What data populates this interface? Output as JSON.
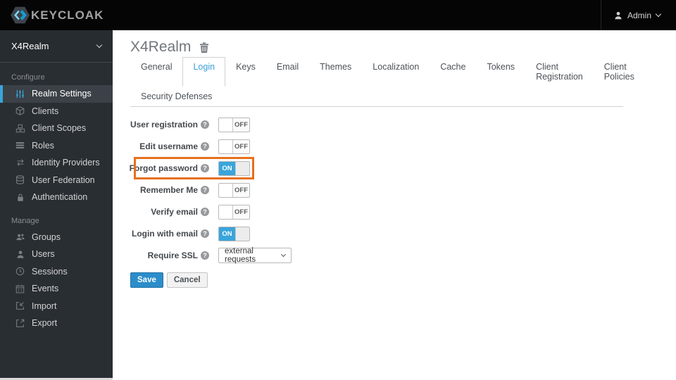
{
  "topnav": {
    "brand": "KEYCLOAK",
    "user": {
      "label": "Admin",
      "icon": "person-icon"
    }
  },
  "sidebar": {
    "realm_selector": {
      "label": "X4Realm",
      "icon": "chevron-down-icon"
    },
    "sections": [
      {
        "label": "Configure",
        "items": [
          {
            "label": "Realm Settings",
            "icon": "sliders-icon",
            "active": true
          },
          {
            "label": "Clients",
            "icon": "cube-icon",
            "active": false
          },
          {
            "label": "Client Scopes",
            "icon": "cubes-icon",
            "active": false
          },
          {
            "label": "Roles",
            "icon": "list-icon",
            "active": false
          },
          {
            "label": "Identity Providers",
            "icon": "exchange-icon",
            "active": false
          },
          {
            "label": "User Federation",
            "icon": "database-icon",
            "active": false
          },
          {
            "label": "Authentication",
            "icon": "lock-icon",
            "active": false
          }
        ]
      },
      {
        "label": "Manage",
        "items": [
          {
            "label": "Groups",
            "icon": "users-icon",
            "active": false
          },
          {
            "label": "Users",
            "icon": "user-icon",
            "active": false
          },
          {
            "label": "Sessions",
            "icon": "clock-icon",
            "active": false
          },
          {
            "label": "Events",
            "icon": "calendar-icon",
            "active": false
          },
          {
            "label": "Import",
            "icon": "import-icon",
            "active": false
          },
          {
            "label": "Export",
            "icon": "export-icon",
            "active": false
          }
        ]
      }
    ]
  },
  "main": {
    "title": "X4Realm",
    "title_icon": "trash-icon",
    "active_tab": "Login",
    "tabs_row1": [
      "General",
      "Login",
      "Keys",
      "Email",
      "Themes",
      "Localization",
      "Cache",
      "Tokens",
      "Client Registration",
      "Client Policies"
    ],
    "tabs_row2": [
      "Security Defenses"
    ],
    "form": {
      "rows": [
        {
          "label": "User registration",
          "type": "toggle",
          "value": "OFF",
          "highlighted": false
        },
        {
          "label": "Edit username",
          "type": "toggle",
          "value": "OFF",
          "highlighted": false
        },
        {
          "label": "Forgot password",
          "type": "toggle",
          "value": "ON",
          "highlighted": true
        },
        {
          "label": "Remember Me",
          "type": "toggle",
          "value": "OFF",
          "highlighted": false
        },
        {
          "label": "Verify email",
          "type": "toggle",
          "value": "OFF",
          "highlighted": false
        },
        {
          "label": "Login with email",
          "type": "toggle",
          "value": "ON",
          "highlighted": false
        },
        {
          "label": "Require SSL",
          "type": "select",
          "value": "external requests",
          "highlighted": false
        }
      ],
      "help_icon": "question-circle-icon",
      "buttons": {
        "save": "Save",
        "cancel": "Cancel"
      }
    }
  },
  "colors": {
    "accent_blue": "#39a5dc",
    "highlight_orange": "#e7701d",
    "save_button": "#2b8dca",
    "sidebar_bg": "#292e33",
    "topnav_bg": "#050505"
  }
}
